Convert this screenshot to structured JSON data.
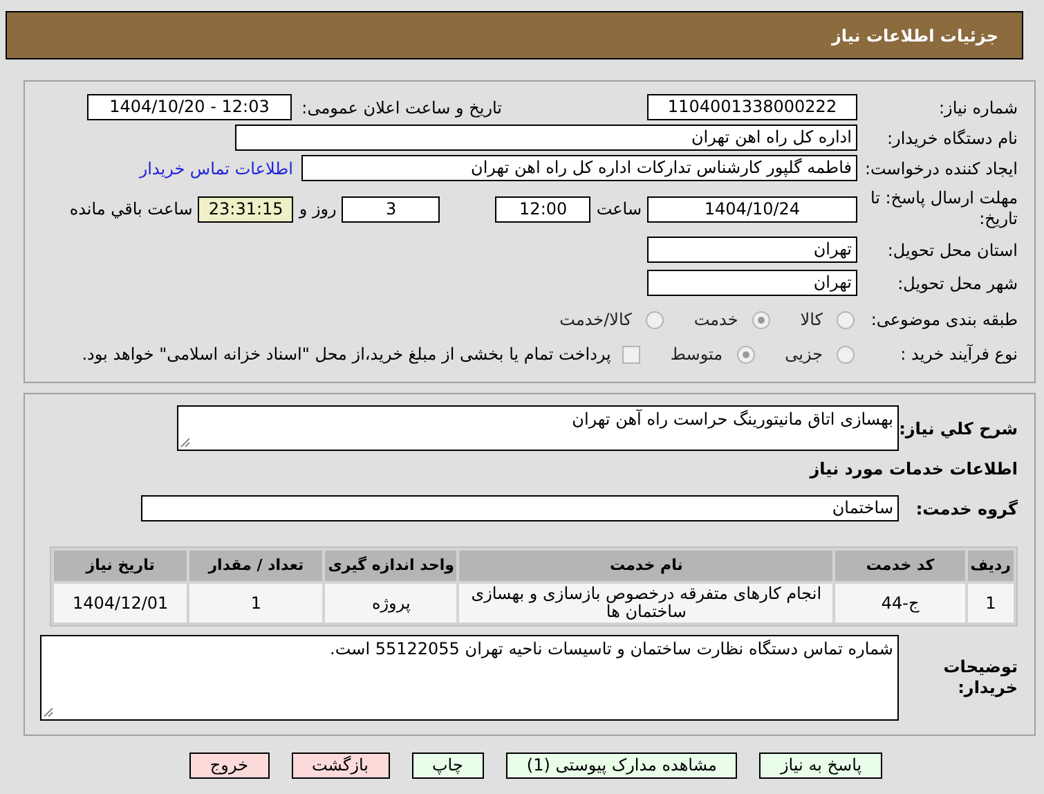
{
  "header": {
    "title": "جزئیات اطلاعات نیاز"
  },
  "need_info": {
    "need_number": {
      "label": "شماره نیاز:",
      "value": "1104001338000222"
    },
    "announce": {
      "label": "تاریخ و ساعت اعلان عمومی:",
      "value": "1404/10/20 - 12:03"
    },
    "buyer": {
      "label": "نام دستگاه خریدار:",
      "value": "اداره کل راه اهن تهران"
    },
    "creator": {
      "label": "ایجاد کننده درخواست:",
      "value": "فاطمه گلپور کارشناس تدارکات اداره کل راه اهن تهران",
      "link": "اطلاعات تماس خریدار"
    },
    "deadline": {
      "label": "مهلت ارسال پاسخ: تا تاریخ:",
      "date": "1404/10/24",
      "time_label": "ساعت",
      "time": "12:00",
      "days": "3",
      "days_label": "روز و",
      "remaining": "23:31:15",
      "remaining_label": "ساعت باقي مانده"
    },
    "province": {
      "label": "استان محل تحویل:",
      "value": "تهران"
    },
    "city": {
      "label": "شهر محل تحویل:",
      "value": "تهران"
    },
    "category": {
      "label": "طبقه بندی موضوعی:",
      "options": [
        {
          "label": "کالا",
          "selected": false
        },
        {
          "label": "خدمت",
          "selected": true
        },
        {
          "label": "کالا/خدمت",
          "selected": false
        }
      ]
    },
    "process": {
      "label": "نوع فرآیند خرید :",
      "options": [
        {
          "label": "جزیی",
          "selected": false
        },
        {
          "label": "متوسط",
          "selected": true
        }
      ],
      "payment": {
        "checked": false,
        "label": "پرداخت تمام یا بخشی از مبلغ خرید،از محل \"اسناد خزانه اسلامی\" خواهد بود."
      }
    }
  },
  "services": {
    "description": {
      "label": "شرح کلي نیاز:",
      "value": "بهسازی اتاق مانیتورینگ حراست راه آهن تهران"
    },
    "heading": "اطلاعات خدمات مورد نیاز",
    "group": {
      "label": "گروه خدمت:",
      "value": "ساختمان"
    },
    "table": {
      "columns": [
        "ردیف",
        "کد خدمت",
        "نام خدمت",
        "واحد اندازه گیری",
        "تعداد / مقدار",
        "تاریخ نیاز"
      ],
      "rows": [
        [
          "1",
          "ج-44",
          "انجام کارهای متفرقه درخصوص بازسازی و بهسازی ساختمان ها",
          "پروژه",
          "1",
          "1404/12/01"
        ]
      ]
    },
    "notes": {
      "label": "توضیحات خریدار:",
      "value": "شماره تماس دستگاه نظارت ساختمان و تاسیسات ناحیه تهران 55122055 است."
    }
  },
  "buttons": [
    {
      "label": "پاسخ به نیاز",
      "kind": "normal"
    },
    {
      "label": "مشاهده مدارک پیوستی (1)",
      "kind": "normal"
    },
    {
      "label": "چاپ",
      "kind": "normal"
    },
    {
      "label": "بازگشت",
      "kind": "exit"
    },
    {
      "label": "خروج",
      "kind": "exit"
    }
  ]
}
